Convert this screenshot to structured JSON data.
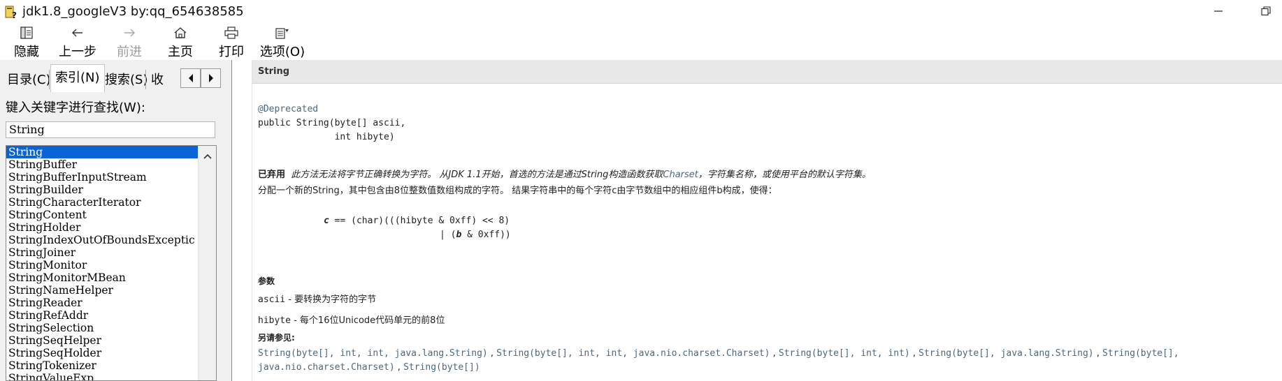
{
  "window": {
    "title": "jdk1.8_googleV3 by:qq_654638585"
  },
  "toolbar": {
    "hide": "隐藏",
    "back": "上一步",
    "forward": "前进",
    "home": "主页",
    "print": "打印",
    "options": "选项(O)"
  },
  "tabs": {
    "contents": "目录(C)",
    "index": "索引(N)",
    "search": "搜索(S)",
    "favorites_partial": "收"
  },
  "search": {
    "label": "键入关键字进行查找(W):",
    "value": "String"
  },
  "index_list": [
    "String",
    "StringBuffer",
    "StringBufferInputStream",
    "StringBuilder",
    "StringCharacterIterator",
    "StringContent",
    "StringHolder",
    "StringIndexOutOfBoundsExceptic",
    "StringJoiner",
    "StringMonitor",
    "StringMonitorMBean",
    "StringNameHelper",
    "StringReader",
    "StringRefAddr",
    "StringSelection",
    "StringSeqHelper",
    "StringSeqHolder",
    "StringTokenizer",
    "StringValueExp"
  ],
  "doc": {
    "header_title": "String",
    "annotation": "@Deprecated",
    "signature_line1": "public String(byte[] ascii,",
    "signature_line2": "              int hibyte)",
    "deprecated_label": "已弃用",
    "deprecated_text": "此方法无法将字节正确转换为字符。 从JDK 1.1开始，首选的方法是通过String构造函数获取",
    "deprecated_link": "Charset",
    "deprecated_tail": "，字符集名称，或使用平台的默认字符集。",
    "description": "分配一个新的String，其中包含由8位整数值数组构成的字符。 结果字符串中的每个字符c由字节数组中的相应组件b构成，使得：",
    "formula_line1_c": "c",
    "formula_line1_rest": " == (char)(((hibyte & 0xff) << 8)",
    "formula_line2_pre": "| (",
    "formula_line2_b": "b",
    "formula_line2_post": " & 0xff))",
    "params_heading": "参数",
    "param1_name": "ascii",
    "param1_desc": " - 要转换为字符的字节",
    "param2_name": "hibyte",
    "param2_desc": " - 每个16位Unicode代码单元的前8位",
    "see_also_heading": "另请参见:",
    "see_links": [
      "String(byte[], int, int, java.lang.String)",
      "String(byte[], int, int, java.nio.charset.Charset)",
      "String(byte[], int, int)",
      "String(byte[], java.lang.String)",
      "String(byte[],",
      "java.nio.charset.Charset)",
      "String(byte[])"
    ],
    "sep": " , "
  }
}
